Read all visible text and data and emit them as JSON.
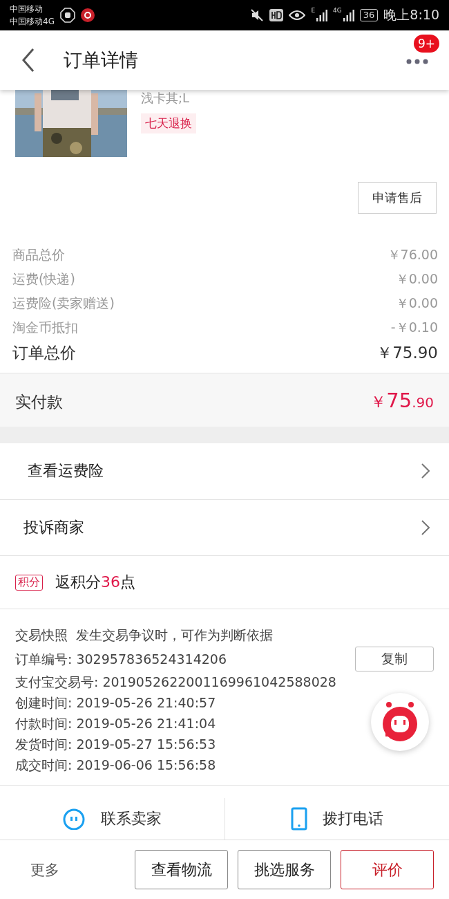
{
  "status_bar": {
    "carrier_1": "中国移动",
    "carrier_2": "中国移动4G",
    "network_1": "E",
    "network_2": "4G",
    "battery": "36",
    "time": "晚上8:10"
  },
  "header": {
    "title": "订单详情",
    "badge": "9+"
  },
  "product": {
    "sku": "浅卡其;L",
    "tag": "七天退换",
    "after_sale_button": "申请售后"
  },
  "costs": [
    {
      "label": "商品总价",
      "value": "￥76.00"
    },
    {
      "label": "运费(快递)",
      "value": "￥0.00"
    },
    {
      "label": "运费险(卖家赠送)",
      "value": "￥0.00"
    },
    {
      "label": "淘金币抵扣",
      "value": "-￥0.10"
    }
  ],
  "order_total": {
    "label": "订单总价",
    "value": "￥75.90"
  },
  "paid": {
    "label": "实付款",
    "currency": "￥",
    "amount_int": "75",
    "amount_dec": ".90"
  },
  "links": [
    {
      "label": "查看运费险"
    },
    {
      "label": "投诉商家"
    }
  ],
  "points": {
    "tag": "积分",
    "prefix": "返积分",
    "amount": "36",
    "suffix": "点"
  },
  "snapshot": {
    "title": "交易快照",
    "note": "发生交易争议时，可作为判断依据",
    "copy_button": "复制",
    "fields": [
      {
        "label": "订单编号:",
        "value": "302957836524314206"
      },
      {
        "label": "支付宝交易号:",
        "value": "2019052622001169961042588028"
      },
      {
        "label": "创建时间:",
        "value": "2019-05-26 21:40:57"
      },
      {
        "label": "付款时间:",
        "value": "2019-05-26 21:41:04"
      },
      {
        "label": "发货时间:",
        "value": "2019-05-27 15:56:53"
      },
      {
        "label": "成交时间:",
        "value": "2019-06-06 15:56:58"
      }
    ]
  },
  "contact": [
    {
      "kind": "chat",
      "label": "联系卖家"
    },
    {
      "kind": "phone",
      "label": "拨打电话"
    }
  ],
  "bottom_bar": {
    "more": "更多",
    "buttons": [
      {
        "label": "查看物流",
        "primary": false
      },
      {
        "label": "挑选服务",
        "primary": false
      },
      {
        "label": "评价",
        "primary": true
      }
    ]
  }
}
